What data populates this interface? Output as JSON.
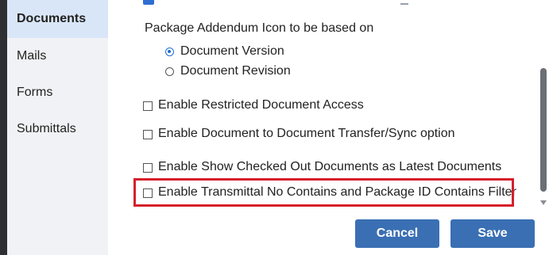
{
  "sidebar": {
    "items": [
      {
        "label": "Documents"
      },
      {
        "label": "Mails"
      },
      {
        "label": "Forms"
      },
      {
        "label": "Submittals"
      }
    ]
  },
  "settings": {
    "addendum_heading": "Package Addendum Icon to be based on",
    "radio_options": [
      {
        "label": "Document Version",
        "checked": true
      },
      {
        "label": "Document Revision",
        "checked": false
      }
    ],
    "checkboxes": [
      {
        "label": "Enable Restricted Document Access",
        "checked": false
      },
      {
        "label": "Enable Document to Document Transfer/Sync option",
        "checked": false
      },
      {
        "label": "Enable Show Checked Out Documents as Latest Documents",
        "checked": false
      },
      {
        "label": "Enable Transmittal No Contains and Package ID Contains Filter",
        "checked": false
      }
    ]
  },
  "footer": {
    "cancel_label": "Cancel",
    "save_label": "Save"
  },
  "colors": {
    "accent": "#3a6fb4",
    "highlight": "#d61f2b",
    "sidebar_active": "#d9e6f7"
  }
}
